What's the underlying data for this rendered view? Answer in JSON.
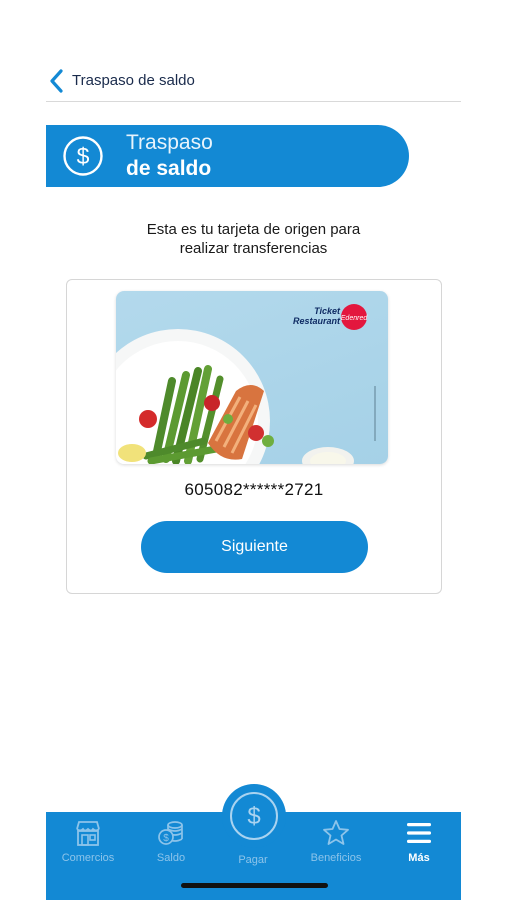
{
  "nav": {
    "back_label": "Traspaso de saldo"
  },
  "banner": {
    "title_line1": "Traspaso",
    "title_line2": "de saldo",
    "icon": "dollar-circle-icon"
  },
  "intro": {
    "text_line1": "Esta es tu tarjeta de origen para",
    "text_line2": "realizar transferencias"
  },
  "card": {
    "image": "ticket-restaurant-card-image",
    "brand_line1": "Ticket",
    "brand_line2": "Restaurant",
    "brand_badge": "Edenred",
    "number": "605082******2721"
  },
  "next_button": {
    "label": "Siguiente"
  },
  "tab_bar": {
    "items": [
      {
        "label": "Comercios",
        "icon": "store-icon"
      },
      {
        "label": "Saldo",
        "icon": "coins-icon"
      },
      {
        "label": "Pagar",
        "icon": "dollar-circle-icon"
      },
      {
        "label": "Beneficios",
        "icon": "star-icon"
      },
      {
        "label": "Más",
        "icon": "menu-icon"
      }
    ],
    "active": "Más"
  },
  "colors": {
    "brand_blue": "#1389d4",
    "inactive_tab": "#8dc4ea",
    "edenred_red": "#e3173e"
  }
}
